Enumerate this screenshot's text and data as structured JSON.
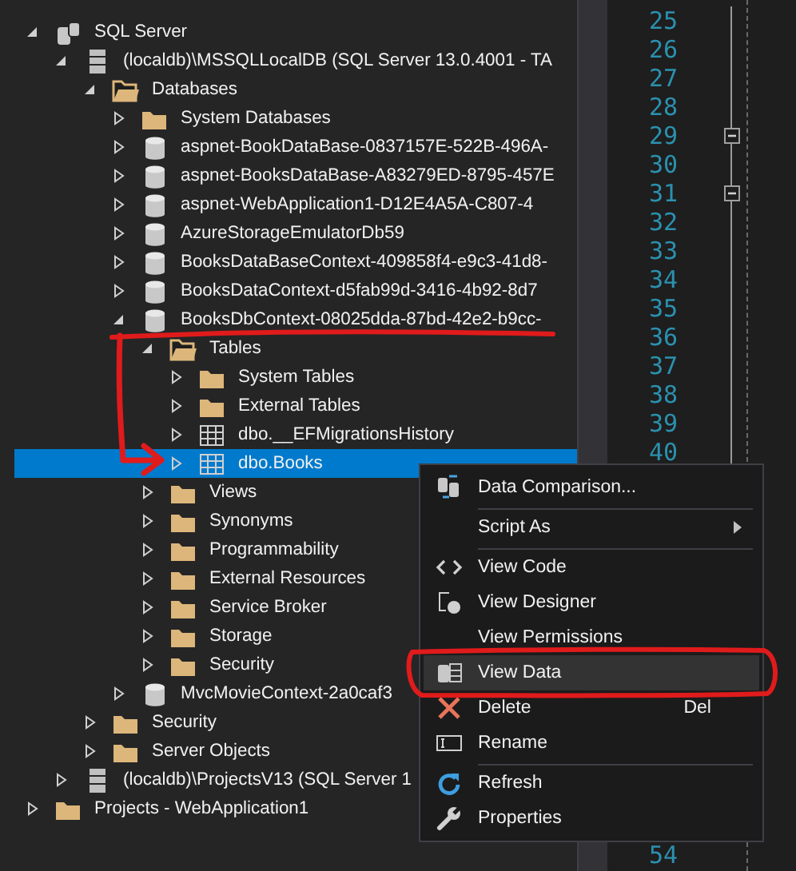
{
  "tree": [
    {
      "label": "SQL Server",
      "kind": "server-group",
      "expanded": true,
      "selected": false,
      "children": [
        {
          "label": "(localdb)\\MSSQLLocalDB (SQL Server 13.0.4001 - TA",
          "kind": "server",
          "expanded": true,
          "selected": false,
          "children": [
            {
              "label": "Databases",
              "kind": "folder",
              "expanded": true,
              "selected": false,
              "children": [
                {
                  "label": "System Databases",
                  "kind": "folder",
                  "expanded": false,
                  "selected": false
                },
                {
                  "label": "aspnet-BookDataBase-0837157E-522B-496A-",
                  "kind": "database",
                  "expanded": false,
                  "selected": false
                },
                {
                  "label": "aspnet-BooksDataBase-A83279ED-8795-457E",
                  "kind": "database",
                  "expanded": false,
                  "selected": false
                },
                {
                  "label": "aspnet-WebApplication1-D12E4A5A-C807-4",
                  "kind": "database",
                  "expanded": false,
                  "selected": false
                },
                {
                  "label": "AzureStorageEmulatorDb59",
                  "kind": "database",
                  "expanded": false,
                  "selected": false
                },
                {
                  "label": "BooksDataBaseContext-409858f4-e9c3-41d8-",
                  "kind": "database",
                  "expanded": false,
                  "selected": false
                },
                {
                  "label": "BooksDataContext-d5fab99d-3416-4b92-8d7",
                  "kind": "database",
                  "expanded": false,
                  "selected": false
                },
                {
                  "label": "BooksDbContext-08025dda-87bd-42e2-b9cc-",
                  "kind": "database",
                  "expanded": true,
                  "selected": false,
                  "children": [
                    {
                      "label": "Tables",
                      "kind": "folder",
                      "expanded": true,
                      "selected": false,
                      "children": [
                        {
                          "label": "System Tables",
                          "kind": "folder",
                          "expanded": false,
                          "selected": false
                        },
                        {
                          "label": "External Tables",
                          "kind": "folder",
                          "expanded": false,
                          "selected": false
                        },
                        {
                          "label": "dbo.__EFMigrationsHistory",
                          "kind": "table",
                          "expanded": false,
                          "selected": false
                        },
                        {
                          "label": "dbo.Books",
                          "kind": "table",
                          "expanded": false,
                          "selected": true
                        }
                      ]
                    },
                    {
                      "label": "Views",
                      "kind": "folder",
                      "expanded": false,
                      "selected": false
                    },
                    {
                      "label": "Synonyms",
                      "kind": "folder",
                      "expanded": false,
                      "selected": false
                    },
                    {
                      "label": "Programmability",
                      "kind": "folder",
                      "expanded": false,
                      "selected": false
                    },
                    {
                      "label": "External Resources",
                      "kind": "folder",
                      "expanded": false,
                      "selected": false
                    },
                    {
                      "label": "Service Broker",
                      "kind": "folder",
                      "expanded": false,
                      "selected": false
                    },
                    {
                      "label": "Storage",
                      "kind": "folder",
                      "expanded": false,
                      "selected": false
                    },
                    {
                      "label": "Security",
                      "kind": "folder",
                      "expanded": false,
                      "selected": false
                    }
                  ]
                },
                {
                  "label": "MvcMovieContext-2a0caf3",
                  "kind": "database",
                  "expanded": false,
                  "selected": false
                }
              ]
            },
            {
              "label": "Security",
              "kind": "folder",
              "expanded": false,
              "selected": false
            },
            {
              "label": "Server Objects",
              "kind": "folder",
              "expanded": false,
              "selected": false
            }
          ]
        },
        {
          "label": "(localdb)\\ProjectsV13 (SQL Server 1",
          "kind": "server",
          "expanded": false,
          "selected": false
        }
      ]
    },
    {
      "label": "Projects - WebApplication1",
      "kind": "folder",
      "expanded": false,
      "selected": false
    }
  ],
  "editor": {
    "line_numbers": [
      {
        "n": "25",
        "fold": false
      },
      {
        "n": "26",
        "fold": false
      },
      {
        "n": "27",
        "fold": false
      },
      {
        "n": "28",
        "fold": false
      },
      {
        "n": "29",
        "fold": true
      },
      {
        "n": "30",
        "fold": false
      },
      {
        "n": "31",
        "fold": true
      },
      {
        "n": "32",
        "fold": false
      },
      {
        "n": "33",
        "fold": false
      },
      {
        "n": "34",
        "fold": false
      },
      {
        "n": "35",
        "fold": false
      },
      {
        "n": "36",
        "fold": false
      },
      {
        "n": "37",
        "fold": false
      },
      {
        "n": "38",
        "fold": false
      },
      {
        "n": "39",
        "fold": false
      },
      {
        "n": "40",
        "fold": false
      }
    ],
    "last_line_number": "54"
  },
  "context_menu": [
    {
      "label": "Data Comparison...",
      "kind": "compare",
      "highlighted": false,
      "submenu": false,
      "separator_after": true
    },
    {
      "label": "Script As",
      "highlighted": false,
      "submenu": true,
      "separator_after": true
    },
    {
      "label": "View Code",
      "kind": "code",
      "highlighted": false,
      "submenu": false,
      "separator_after": false
    },
    {
      "label": "View Designer",
      "kind": "designer",
      "highlighted": false,
      "submenu": false,
      "separator_after": false
    },
    {
      "label": "View Permissions",
      "highlighted": false,
      "submenu": false,
      "separator_after": false
    },
    {
      "label": "View Data",
      "kind": "data",
      "highlighted": true,
      "submenu": false,
      "separator_after": false
    },
    {
      "label": "Delete",
      "kind": "delete",
      "shortcut": "Del",
      "highlighted": false,
      "submenu": false,
      "separator_after": false
    },
    {
      "label": "Rename",
      "kind": "rename",
      "highlighted": false,
      "submenu": false,
      "separator_after": true
    },
    {
      "label": "Refresh",
      "kind": "refresh",
      "highlighted": false,
      "submenu": false,
      "separator_after": false
    },
    {
      "label": "Properties",
      "kind": "wrench",
      "highlighted": false,
      "submenu": false,
      "separator_after": false
    }
  ]
}
